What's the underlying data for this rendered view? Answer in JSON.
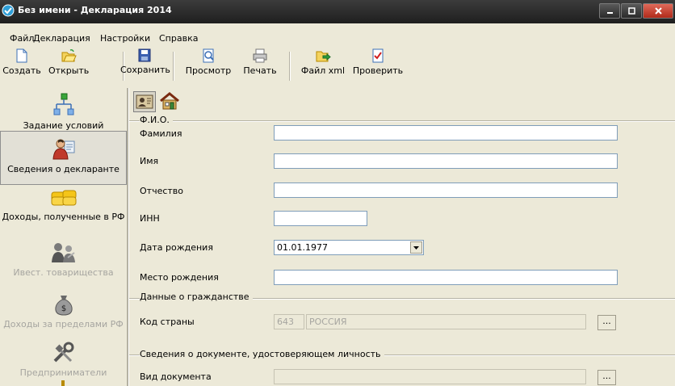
{
  "window": {
    "title": "Без имени - Декларация 2014"
  },
  "menu": [
    "Файл",
    "Декларация",
    "Настройки",
    "Справка"
  ],
  "toolbar": {
    "create": "Создать",
    "open": "Открыть",
    "save": "Сохранить",
    "preview": "Просмотр",
    "print": "Печать",
    "xml": "Файл xml",
    "check": "Проверить"
  },
  "nav": [
    {
      "label": "Задание условий",
      "icon": "org-chart-icon",
      "state": "normal"
    },
    {
      "label": "Сведения о декларанте",
      "icon": "person-icon",
      "state": "active"
    },
    {
      "label": "Доходы, полученные в РФ",
      "icon": "coins-icon",
      "state": "normal"
    },
    {
      "label": "Ивест. товарищества",
      "icon": "partners-icon",
      "state": "disabled"
    },
    {
      "label": "Доходы за пределами РФ",
      "icon": "money-bag-icon",
      "state": "disabled"
    },
    {
      "label": "Предприниматели",
      "icon": "tools-icon",
      "state": "disabled"
    }
  ],
  "form": {
    "fio_group": "Ф.И.О.",
    "surname_label": "Фамилия",
    "surname_value": "",
    "name_label": "Имя",
    "name_value": "",
    "patronymic_label": "Отчество",
    "patronymic_value": "",
    "inn_label": "ИНН",
    "inn_value": "",
    "birthdate_label": "Дата рождения",
    "birthdate_value": "01.01.1977",
    "birthplace_label": "Место рождения",
    "birthplace_value": "",
    "citizenship_group": "Данные о гражданстве",
    "country_code_label": "Код страны",
    "country_code_value": "643",
    "country_name_value": "РОССИЯ",
    "ellipsis": "...",
    "document_group": "Сведения о документе, удостоверяющем личность",
    "doc_type_label": "Вид документа",
    "doc_type_value": ""
  },
  "colors": {
    "titlebar": "#2a2a2a",
    "background": "#ece9d8",
    "field_border": "#7f9db9",
    "disabled_text": "#a6a5a0"
  }
}
